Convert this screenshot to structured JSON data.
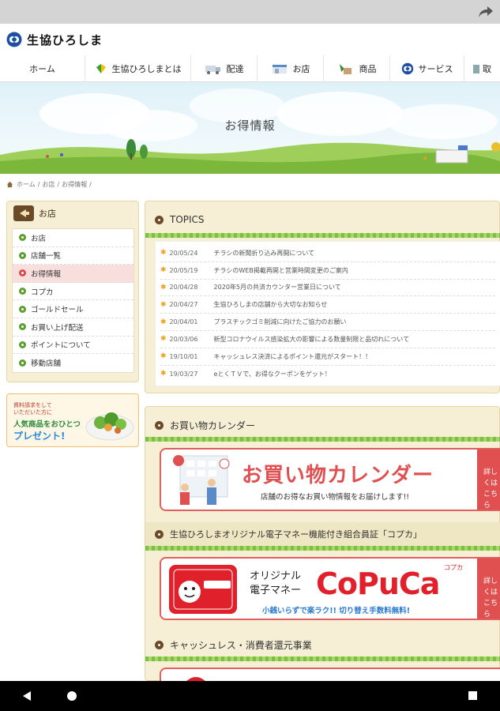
{
  "browser": {
    "share_icon": "share-arrow-icon"
  },
  "site": {
    "logo_text": "生協ひろしま",
    "logo_icon": "coop-logo-icon"
  },
  "gnav": [
    {
      "label": "ホーム",
      "icon": ""
    },
    {
      "label": "生協ひろしまとは",
      "icon": "leaf-badge-icon"
    },
    {
      "label": "配達",
      "icon": "truck-icon"
    },
    {
      "label": "お店",
      "icon": "store-icon"
    },
    {
      "label": "商品",
      "icon": "product-icon"
    },
    {
      "label": "サービス",
      "icon": "coop-logo-icon"
    },
    {
      "label": "取",
      "icon": "book-icon"
    }
  ],
  "hero": {
    "title": "お得情報"
  },
  "breadcrumb": [
    "ホーム",
    "お店",
    "お得情報"
  ],
  "sidenav": {
    "header": "お店",
    "items": [
      "お店",
      "店舗一覧",
      "お得情報",
      "コプカ",
      "ゴールドセール",
      "お買い上げ配送",
      "ポイントについて",
      "移動店舗"
    ],
    "active_index": 2
  },
  "promo": {
    "line1": "資料請求をして",
    "line2": "いただいた方に",
    "line3": "人気商品をおひとつ",
    "line4": "プレゼント!"
  },
  "topics": {
    "title": "TOPICS",
    "items": [
      {
        "date": "20/05/24",
        "text": "チラシの新聞折り込み再開について"
      },
      {
        "date": "20/05/19",
        "text": "チラシのWEB掲載再開と営業時間変更のご案内"
      },
      {
        "date": "20/04/28",
        "text": "2020年5月の共済カウンター営業日について"
      },
      {
        "date": "20/04/27",
        "text": "生協ひろしまの店舗から大切なお知らせ"
      },
      {
        "date": "20/04/01",
        "text": "プラスチックゴミ削減に向けたご協力のお願い"
      },
      {
        "date": "20/03/06",
        "text": "新型コロナウイルス感染拡大の影響による数量制限と品切れについて"
      },
      {
        "date": "19/10/01",
        "text": "キャッシュレス決済によるポイント還元がスタート！！"
      },
      {
        "date": "19/03/27",
        "text": "eとくＴＶで、お得なクーポンをゲット！"
      }
    ]
  },
  "calendar": {
    "section_title": "お買い物カレンダー",
    "banner_title": "お買い物カレンダー",
    "banner_sub": "店舗のお得なお買い物情報をお届けします!!",
    "side_label": "詳しくはこちら"
  },
  "copuca": {
    "section_title": "生協ひろしまオリジナル電子マネー機能付き組合員証「コプカ」",
    "line1": "オリジナル",
    "line2": "電子マネー",
    "logo": "CoPuCa",
    "kana": "コプカ",
    "sub": "小銭いらずで楽ラク!! 切り替え手数料無料!",
    "side_label": "詳しくはこちら"
  },
  "cashless": {
    "section_title": "キャッシュレス・消費者還元事業"
  },
  "colors": {
    "green": "#7cc043",
    "brown": "#6b4a2a",
    "red": "#e05050",
    "beige": "#f6efd6"
  }
}
